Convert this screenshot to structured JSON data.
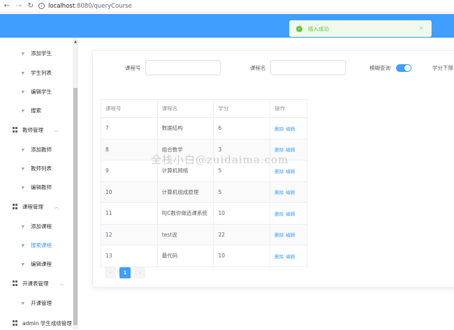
{
  "browser": {
    "url_host": "localhost",
    "url_path": ":8080/queryCourse"
  },
  "toast": {
    "message": "插入成功",
    "close": "×"
  },
  "sidebar": {
    "items": [
      {
        "label": "添加学生",
        "kind": "sub",
        "icon": "paper-plane-icon"
      },
      {
        "label": "学生列表",
        "kind": "sub",
        "icon": "paper-plane-icon"
      },
      {
        "label": "编辑学生",
        "kind": "sub",
        "icon": "paper-plane-icon"
      },
      {
        "label": "搜索",
        "kind": "sub",
        "icon": "paper-plane-icon"
      },
      {
        "label": "教师管理",
        "kind": "group",
        "icon": "grid-icon"
      },
      {
        "label": "添加教师",
        "kind": "sub",
        "icon": "paper-plane-icon"
      },
      {
        "label": "教师列表",
        "kind": "sub",
        "icon": "paper-plane-icon"
      },
      {
        "label": "编辑教师",
        "kind": "sub",
        "icon": "paper-plane-icon"
      },
      {
        "label": "课程管理",
        "kind": "group",
        "icon": "grid-icon"
      },
      {
        "label": "添加课程",
        "kind": "sub",
        "icon": "paper-plane-icon"
      },
      {
        "label": "搜索课程",
        "kind": "sub",
        "icon": "paper-plane-icon",
        "active": true
      },
      {
        "label": "编辑课程",
        "kind": "sub",
        "icon": "paper-plane-icon"
      },
      {
        "label": "开课表管理",
        "kind": "group",
        "icon": "grid-icon"
      },
      {
        "label": "开课管理",
        "kind": "sub",
        "icon": "paper-plane-icon"
      },
      {
        "label": "admin 学生成绩管理",
        "kind": "group",
        "icon": "grid-icon"
      }
    ]
  },
  "search": {
    "course_id_label": "课程号",
    "course_id_value": "",
    "course_name_label": "课程名",
    "course_name_value": "",
    "fuzzy_label": "模糊查询",
    "fuzzy_on": true,
    "credit_min_label": "学分下限"
  },
  "table": {
    "headers": [
      "课程号",
      "课程名",
      "学分",
      "操作"
    ],
    "rows": [
      {
        "id": "7",
        "name": "数据结构",
        "credit": "6"
      },
      {
        "id": "8",
        "name": "组合数学",
        "credit": "3"
      },
      {
        "id": "9",
        "name": "计算机网络",
        "credit": "5"
      },
      {
        "id": "10",
        "name": "计算机组成原理",
        "credit": "5"
      },
      {
        "id": "11",
        "name": "RJC教你做选课系统",
        "credit": "10"
      },
      {
        "id": "12",
        "name": "test说",
        "credit": "22"
      },
      {
        "id": "13",
        "name": "最代码",
        "credit": "10"
      }
    ],
    "delete_label": "删除",
    "edit_label": "编辑"
  },
  "pagination": {
    "prev": "‹",
    "current": "1",
    "next": "›"
  },
  "watermark": "全栈小白@zuidaima.com",
  "colors": {
    "primary": "#409eff",
    "success": "#67c23a"
  }
}
